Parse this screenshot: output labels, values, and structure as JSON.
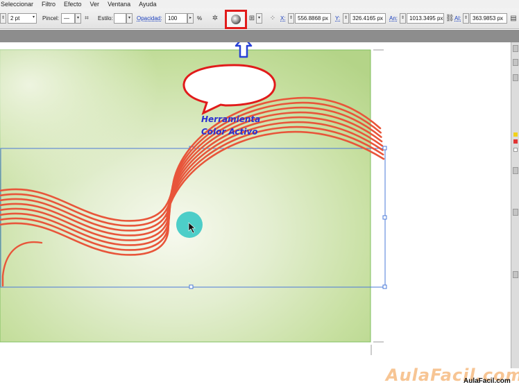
{
  "menu": [
    "Seleccionar",
    "Filtro",
    "Efecto",
    "Ver",
    "Ventana",
    "Ayuda"
  ],
  "control": {
    "stroke_weight": "2 pt",
    "pincel_label": "Pincel:",
    "estilo_label": "Estilo:",
    "opacidad_label": "Opacidad:",
    "opacidad_value": "100",
    "percent": "%",
    "x_label": "X:",
    "x_value": "556.8868 px",
    "y_label": "Y:",
    "y_value": "326.4165 px",
    "an_label": "An:",
    "an_value": "1013.3495 px",
    "al_label": "Al:",
    "al_value": "363.9853 px"
  },
  "callout": {
    "line1": "Herramienta",
    "line2": "Color Activo"
  },
  "watermark": {
    "brand": "AulaFacil.com",
    "small": "AulaFacil.com"
  },
  "colors": {
    "artboard_green": "#b9d98e",
    "stroke_red": "#e8553a",
    "selection_blue": "#4a78d8",
    "highlight_red": "#e11b1b",
    "arrow_blue": "#2740d6"
  },
  "icons": [
    "active-color-tool-icon",
    "brush-icon",
    "style-icon",
    "link-icon"
  ]
}
